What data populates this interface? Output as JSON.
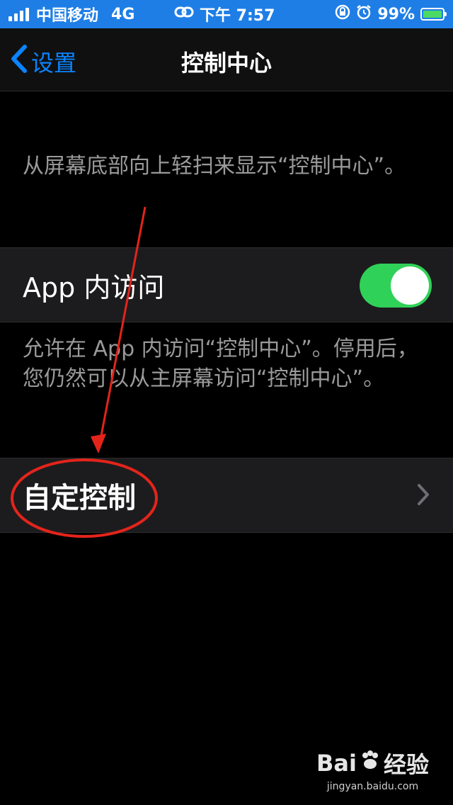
{
  "status_bar": {
    "carrier": "中国移动",
    "network": "4G",
    "time": "下午 7:57",
    "battery_percent": "99%",
    "battery_level": 0.99
  },
  "nav": {
    "back_label": "设置",
    "title": "控制中心"
  },
  "description_top": "从屏幕底部向上轻扫来显示“控制中心”。",
  "in_app_access": {
    "label": "App 内访问",
    "enabled": true
  },
  "description_bottom": "允许在 App 内访问“控制中心”。停用后，您仍然可以从主屏幕访问“控制中心”。",
  "customize": {
    "label": "自定控制"
  },
  "watermark": {
    "brand": "Bai",
    "brand_suffix": "经验",
    "url": "jingyan.baidu.com"
  },
  "colors": {
    "accent_blue": "#0a84ff",
    "toggle_on": "#30d158",
    "annotation_red": "#e3241b"
  },
  "icons": [
    "signal-icon",
    "link-icon",
    "lock-rotation-icon",
    "alarm-icon",
    "battery-icon",
    "back-chevron-icon",
    "chevron-right-icon",
    "baidu-paw-icon"
  ]
}
